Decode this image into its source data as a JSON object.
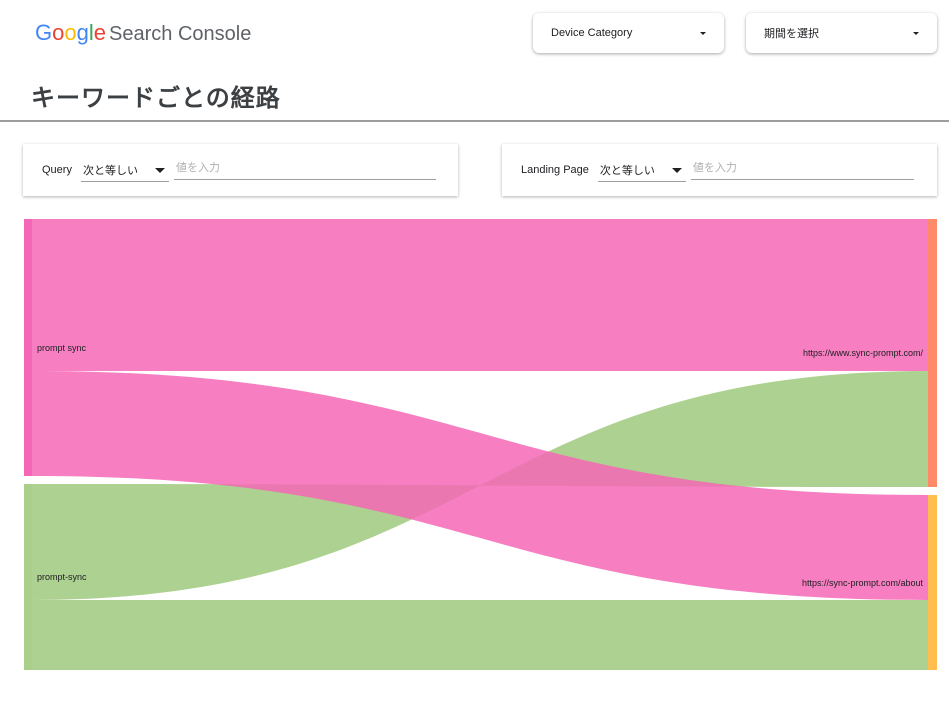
{
  "header": {
    "logo": {
      "part1": "G",
      "part2": "o",
      "part3": "o",
      "part4": "g",
      "part5": "l",
      "part6": "e",
      "product": "Search Console"
    },
    "device_dropdown": {
      "label": "Device Category"
    },
    "period_dropdown": {
      "label": "期間を選択"
    }
  },
  "page": {
    "title": "キーワードごとの経路"
  },
  "filters": {
    "query": {
      "label": "Query",
      "operator": "次と等しい",
      "placeholder": "値を入力"
    },
    "landing_page": {
      "label": "Landing Page",
      "operator": "次と等しい",
      "placeholder": "値を入力"
    }
  },
  "sankey": {
    "sources": [
      {
        "name": "prompt sync",
        "color": "#f467b6"
      },
      {
        "name": "prompt-sync",
        "color": "#a9cf8a"
      }
    ],
    "targets": [
      {
        "name": "https://www.sync-prompt.com/",
        "color": "#ff8a6a"
      },
      {
        "name": "https://sync-prompt.com/about",
        "color": "#ffbe4f"
      }
    ],
    "flows": [
      {
        "source": "prompt sync",
        "target": "https://www.sync-prompt.com/",
        "color": "#f467b6"
      },
      {
        "source": "prompt sync",
        "target": "https://sync-prompt.com/about",
        "color": "#f467b6"
      },
      {
        "source": "prompt-sync",
        "target": "https://www.sync-prompt.com/",
        "color": "#a9cf8a"
      },
      {
        "source": "prompt-sync",
        "target": "https://sync-prompt.com/about",
        "color": "#a9cf8a"
      }
    ]
  }
}
